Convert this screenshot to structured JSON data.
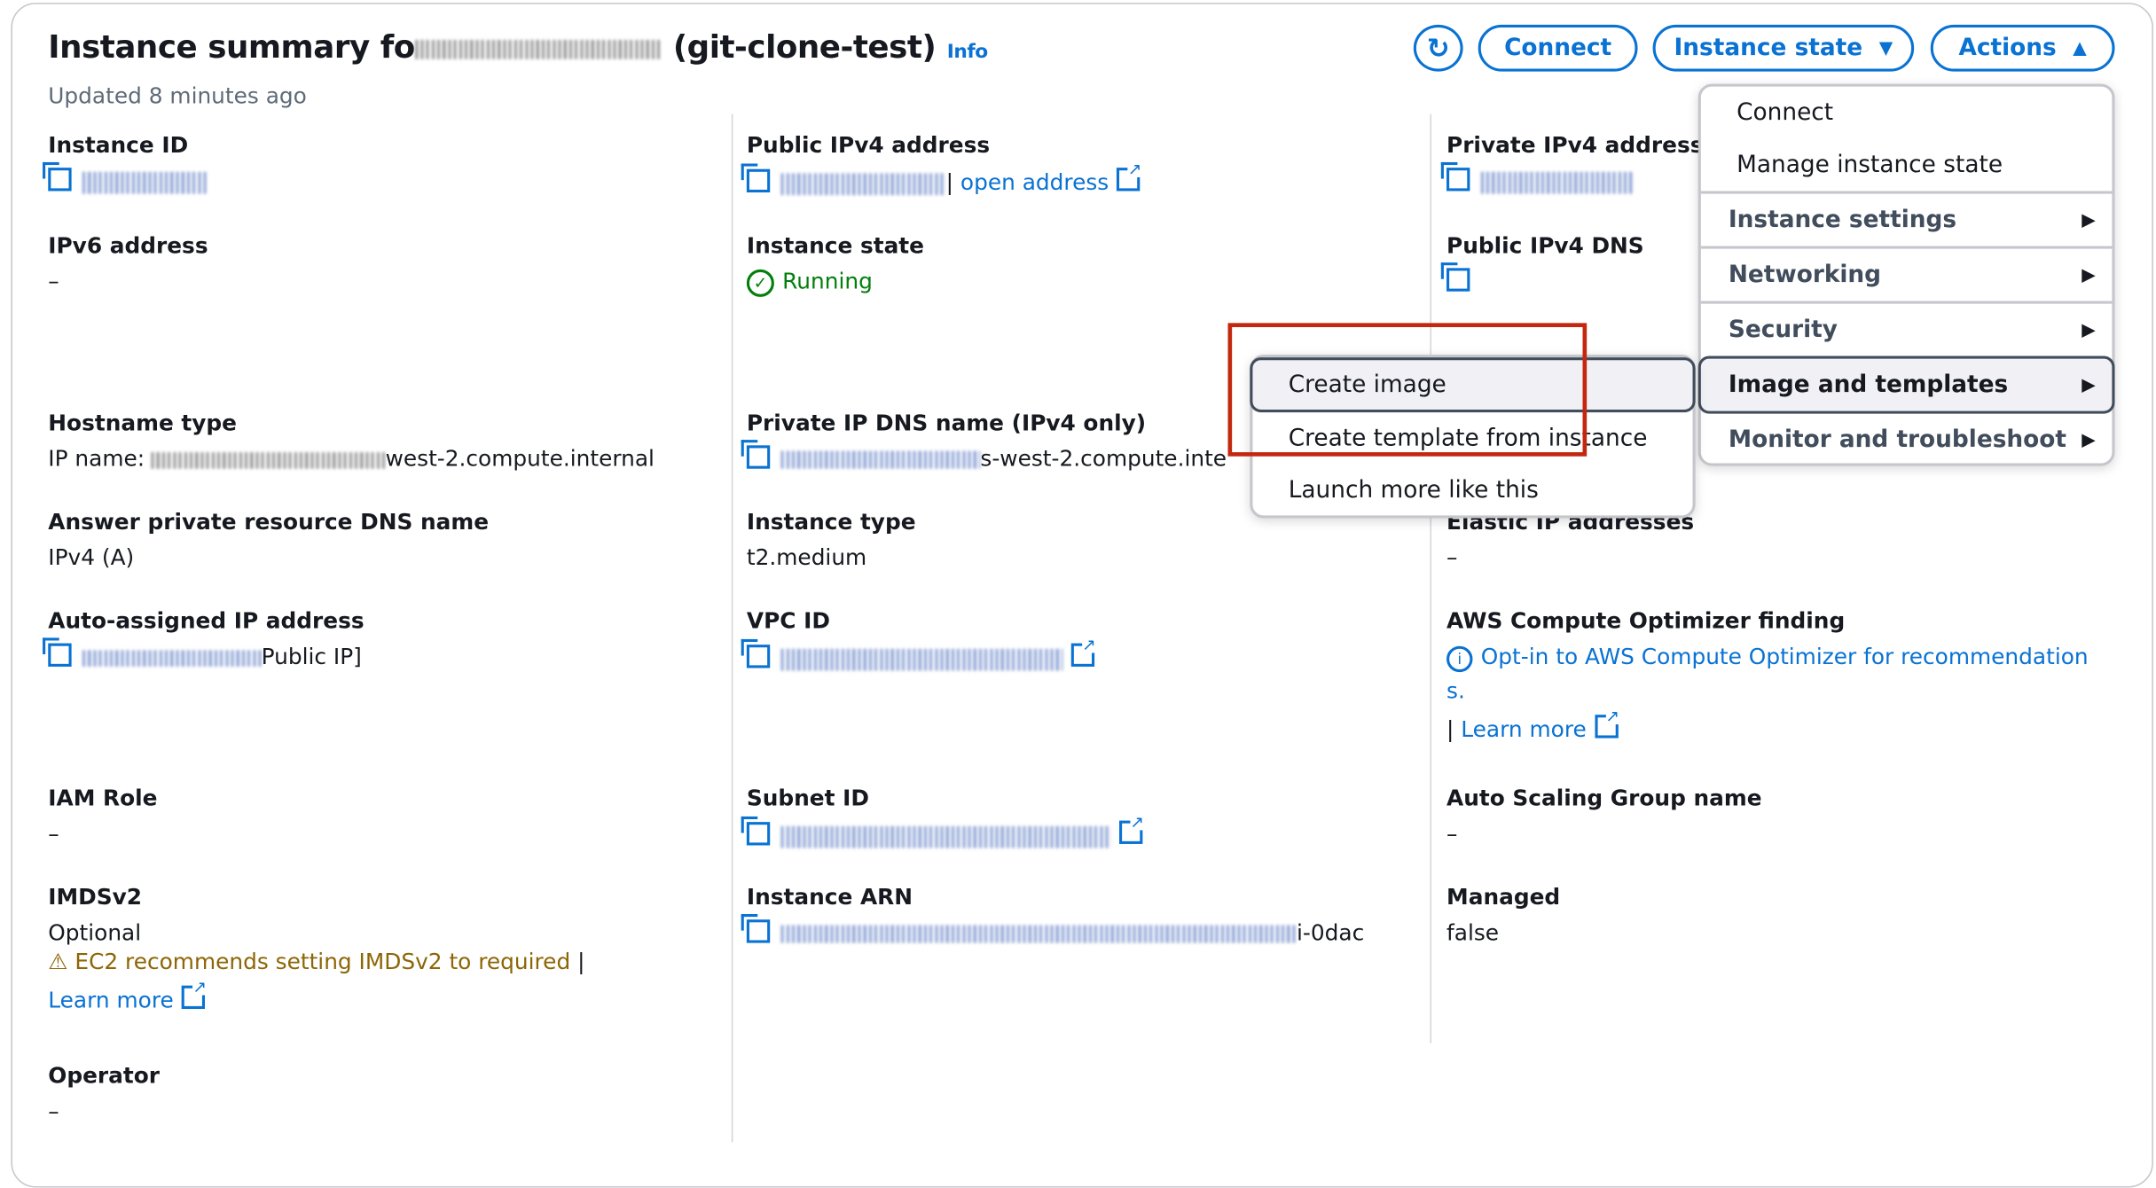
{
  "header": {
    "title_prefix": "Instance summary fo",
    "title_suffix": "(git-clone-test)",
    "info_link": "Info",
    "updated": "Updated 8 minutes ago"
  },
  "toolbar": {
    "refresh_icon": "refresh-icon",
    "connect": "Connect",
    "instance_state": "Instance state",
    "actions": "Actions",
    "accent": "#0972d3"
  },
  "columns": {
    "c1": [
      {
        "label": "Instance ID",
        "value": ""
      },
      {
        "label": "IPv6 address",
        "value": "–"
      },
      {
        "label": "Hostname type",
        "value_prefix": "IP name: ",
        "value_suffix": "west-2.compute.internal"
      },
      {
        "label": "Answer private resource DNS name",
        "value": "IPv4 (A)"
      },
      {
        "label": "Auto-assigned IP address",
        "value_suffix": "Public IP]"
      },
      {
        "label": "IAM Role",
        "value": "–"
      },
      {
        "label": "IMDSv2",
        "value": "Optional",
        "warning": "EC2 recommends setting IMDSv2 to required",
        "learn_more": "Learn more"
      },
      {
        "label": "Operator",
        "value": "–"
      }
    ],
    "c2": [
      {
        "label": "Public IPv4 address",
        "link": "open address"
      },
      {
        "label": "Instance state",
        "value": "Running",
        "status_color": "#037f0c"
      },
      {
        "label": "Private IP DNS name (IPv4 only)",
        "value_suffix": "s-west-2.compute.inte"
      },
      {
        "label": "Instance type",
        "value": "t2.medium"
      },
      {
        "label": "VPC ID"
      },
      {
        "label": "Subnet ID"
      },
      {
        "label": "Instance ARN",
        "value_suffix": "i-0dac"
      }
    ],
    "c3": [
      {
        "label": "Private IPv4 addresse"
      },
      {
        "label": "Public IPv4 DNS"
      },
      {
        "label": "Elastic IP addresses",
        "value": "–"
      },
      {
        "label": "AWS Compute Optimizer finding",
        "link": "Opt-in to AWS Compute Optimizer for recommendation",
        "link_wrap": "s.",
        "learn_more": "Learn more"
      },
      {
        "label": "Auto Scaling Group name",
        "value": "–"
      },
      {
        "label": "Managed",
        "value": "false"
      }
    ]
  },
  "actions_menu": {
    "items": [
      "Connect",
      "Manage instance state"
    ],
    "groups": [
      "Instance settings",
      "Networking",
      "Security",
      "Image and templates",
      "Monitor and troubleshoot"
    ],
    "active_group": "Image and templates"
  },
  "submenu": {
    "items": [
      "Create image",
      "Create template from instance",
      "Launch more like this"
    ],
    "active": "Create image"
  }
}
